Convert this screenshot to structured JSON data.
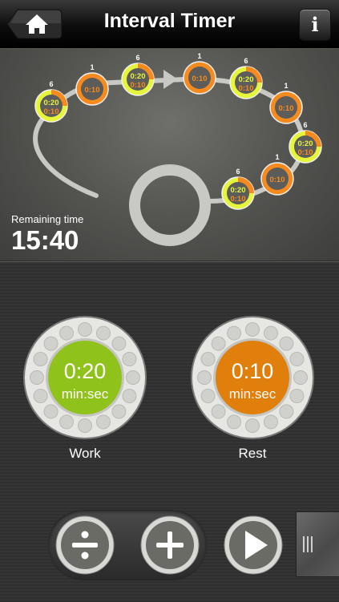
{
  "navbar": {
    "title": "Interval Timer",
    "info_label": "i"
  },
  "icons": {
    "home": "home-icon",
    "info": "info-icon",
    "divide": "divide-icon",
    "add": "plus-icon",
    "play": "play-icon",
    "drawer": "drawer-handle-icon"
  },
  "timeline": {
    "nodes": [
      {
        "count": "6",
        "work": "0:20",
        "rest": "0:10"
      },
      {
        "count": "1",
        "rest": "0:10"
      },
      {
        "count": "6",
        "work": "0:20",
        "rest": "0:10"
      },
      {
        "count": "1",
        "rest": "0:10"
      },
      {
        "count": "6",
        "work": "0:20",
        "rest": "0:10"
      },
      {
        "count": "1",
        "rest": "0:10"
      },
      {
        "count": "6",
        "work": "0:20",
        "rest": "0:10"
      },
      {
        "count": "1",
        "rest": "0:10"
      },
      {
        "count": "6",
        "work": "0:20",
        "rest": "0:10"
      }
    ]
  },
  "remaining": {
    "label": "Remaining time",
    "value": "15:40"
  },
  "work_dial": {
    "value": "0:20",
    "unit": "min:sec",
    "label": "Work"
  },
  "rest_dial": {
    "value": "0:10",
    "unit": "min:sec",
    "label": "Rest"
  },
  "colors": {
    "work": "#8fc21a",
    "rest": "#e07f0c",
    "work_ring": "#e6f53c",
    "rest_ring": "#f58a1f"
  }
}
